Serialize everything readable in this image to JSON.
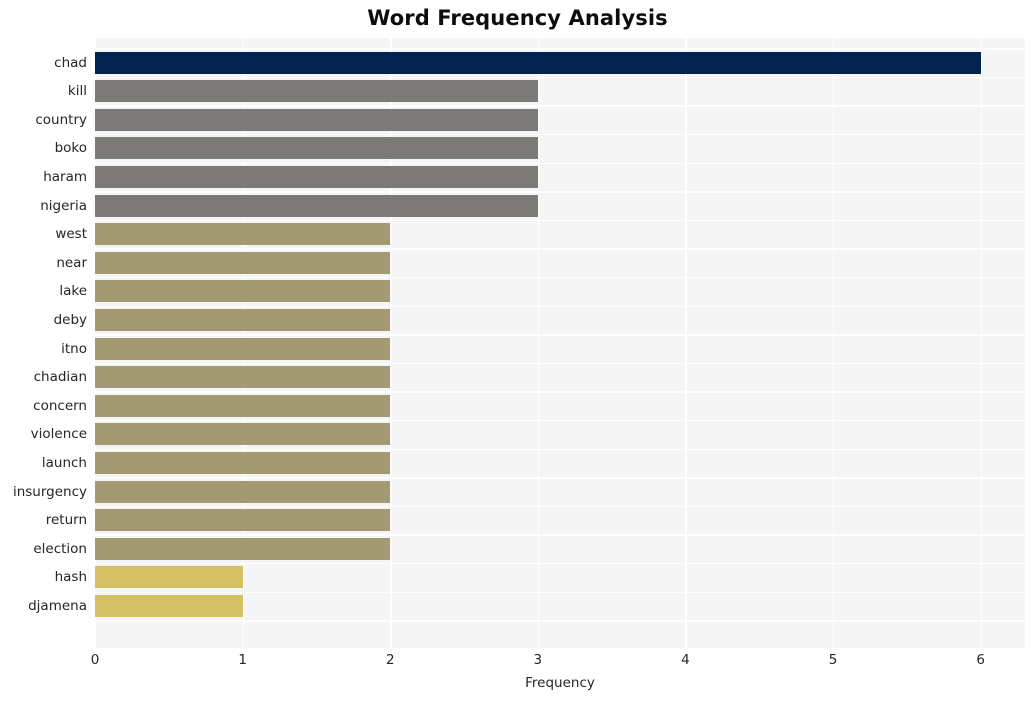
{
  "chart_data": {
    "type": "bar",
    "orientation": "horizontal",
    "title": "Word Frequency Analysis",
    "xlabel": "Frequency",
    "ylabel": "",
    "xlim": [
      0,
      6.3
    ],
    "xticks": [
      "0",
      "1",
      "2",
      "3",
      "4",
      "5",
      "6"
    ],
    "xtick_values": [
      0,
      1,
      2,
      3,
      4,
      5,
      6
    ],
    "grid": true,
    "legend": false,
    "categories": [
      "chad",
      "kill",
      "country",
      "boko",
      "haram",
      "nigeria",
      "west",
      "near",
      "lake",
      "deby",
      "itno",
      "chadian",
      "concern",
      "violence",
      "launch",
      "insurgency",
      "return",
      "election",
      "hash",
      "djamena"
    ],
    "values": [
      6,
      3,
      3,
      3,
      3,
      3,
      2,
      2,
      2,
      2,
      2,
      2,
      2,
      2,
      2,
      2,
      2,
      2,
      1,
      1
    ],
    "bar_colors": [
      "#04224e",
      "#7b7a77",
      "#7b7a77",
      "#7b7a77",
      "#7b7a77",
      "#7b7a77",
      "#a39a74",
      "#a39a74",
      "#a39a74",
      "#a39a74",
      "#a39a74",
      "#a39a74",
      "#a39a74",
      "#a39a74",
      "#a39a74",
      "#a39a74",
      "#a39a74",
      "#a39a74",
      "#d4c163",
      "#d4c163"
    ],
    "plot_background": "#f5f5f5",
    "grid_color": "#ffffff",
    "figure_background": "#ffffff",
    "text_color": "#262626"
  }
}
